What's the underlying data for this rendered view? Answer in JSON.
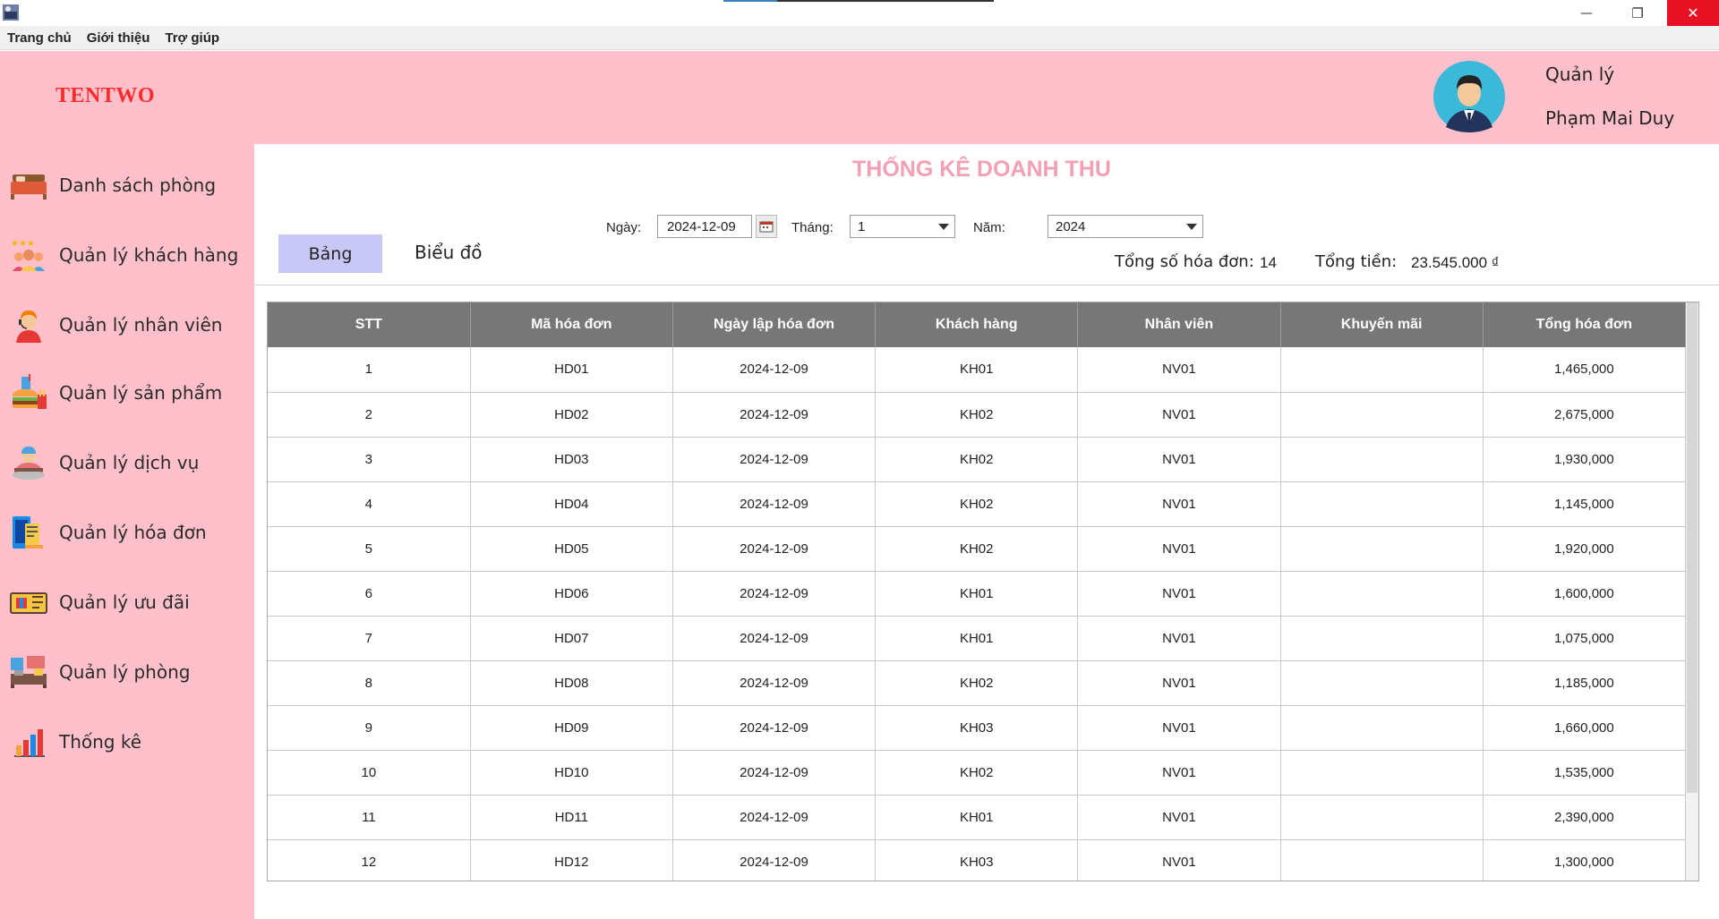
{
  "window": {
    "min_glyph": "—",
    "max_glyph": "❐",
    "close_glyph": "✕",
    "close_color": "#e81123"
  },
  "menu": [
    "Trang chủ",
    "Giới thiệu",
    "Trợ giúp"
  ],
  "header": {
    "brand": "TENTWO",
    "role": "Quản lý",
    "username": "Phạm Mai Duy",
    "avatar_icon": "user-avatar-icon",
    "background": "#ffc0cb"
  },
  "sidebar": {
    "items": [
      {
        "label": "Danh sách phòng",
        "icon": "bed-icon"
      },
      {
        "label": "Quản lý khách hàng",
        "icon": "customers-stars-icon"
      },
      {
        "label": "Quản lý nhân viên",
        "icon": "staff-headset-icon"
      },
      {
        "label": "Quản lý sản phẩm",
        "icon": "food-drink-icon"
      },
      {
        "label": "Quản lý dịch vụ",
        "icon": "service-icon"
      },
      {
        "label": "Quản lý hóa đơn",
        "icon": "invoice-icon"
      },
      {
        "label": "Quản lý ưu đãi",
        "icon": "voucher-icon"
      },
      {
        "label": "Quản lý phòng",
        "icon": "room-icon"
      },
      {
        "label": "Thống kê",
        "icon": "bar-chart-icon"
      }
    ]
  },
  "main": {
    "title": "THỐNG KÊ DOANH THU",
    "title_color": "#f2a0b4",
    "filters": {
      "date_label": "Ngày:",
      "date_value": "2024-12-09",
      "month_label": "Tháng:",
      "month_value": "1",
      "year_label": "Năm:",
      "year_value": "2024"
    },
    "tabs": {
      "table": "Bảng",
      "chart": "Biểu đồ",
      "active_color": "#c9c7f5"
    },
    "summary": {
      "count_label": "Tổng số hóa đơn:",
      "count_value": "14",
      "total_label": "Tổng tiền:",
      "total_value": "23.545.000 ₫"
    },
    "table": {
      "columns": [
        "STT",
        "Mã hóa đơn",
        "Ngày lập hóa đơn",
        "Khách hàng",
        "Nhân viên",
        "Khuyến mãi",
        "Tổng hóa đơn"
      ],
      "rows": [
        [
          "1",
          "HD01",
          "2024-12-09",
          "KH01",
          "NV01",
          "",
          "1,465,000"
        ],
        [
          "2",
          "HD02",
          "2024-12-09",
          "KH02",
          "NV01",
          "",
          "2,675,000"
        ],
        [
          "3",
          "HD03",
          "2024-12-09",
          "KH02",
          "NV01",
          "",
          "1,930,000"
        ],
        [
          "4",
          "HD04",
          "2024-12-09",
          "KH02",
          "NV01",
          "",
          "1,145,000"
        ],
        [
          "5",
          "HD05",
          "2024-12-09",
          "KH02",
          "NV01",
          "",
          "1,920,000"
        ],
        [
          "6",
          "HD06",
          "2024-12-09",
          "KH01",
          "NV01",
          "",
          "1,600,000"
        ],
        [
          "7",
          "HD07",
          "2024-12-09",
          "KH01",
          "NV01",
          "",
          "1,075,000"
        ],
        [
          "8",
          "HD08",
          "2024-12-09",
          "KH02",
          "NV01",
          "",
          "1,185,000"
        ],
        [
          "9",
          "HD09",
          "2024-12-09",
          "KH03",
          "NV01",
          "",
          "1,660,000"
        ],
        [
          "10",
          "HD10",
          "2024-12-09",
          "KH02",
          "NV01",
          "",
          "1,535,000"
        ],
        [
          "11",
          "HD11",
          "2024-12-09",
          "KH01",
          "NV01",
          "",
          "2,390,000"
        ],
        [
          "12",
          "HD12",
          "2024-12-09",
          "KH03",
          "NV01",
          "",
          "1,300,000"
        ]
      ]
    }
  }
}
